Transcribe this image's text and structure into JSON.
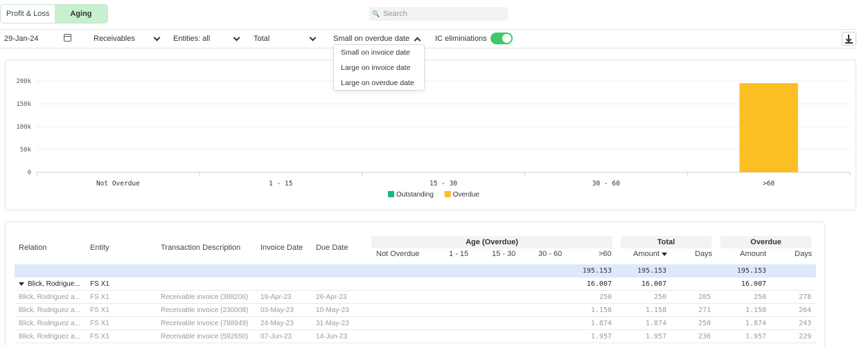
{
  "tabs": [
    {
      "label": "Profit & Loss",
      "active": false
    },
    {
      "label": "Aging",
      "active": true
    }
  ],
  "search": {
    "placeholder": "Search",
    "icon": "search-icon"
  },
  "filters": {
    "date": "29-Jan-24",
    "type": "Receivables",
    "entities": "Entities: all",
    "scope": "Total",
    "sort": "Small on overdue date",
    "sort_options": [
      "Small on invoice date",
      "Large on invoice date",
      "Large on overdue date"
    ],
    "ic_label": "IC eliminiations",
    "ic_enabled": true
  },
  "colors": {
    "outstanding": "#1db87a",
    "overdue": "#fbbf24",
    "accent": "#3ec86a",
    "highlight_row": "#dbe9fb"
  },
  "chart_data": {
    "type": "bar",
    "categories": [
      "Not Overdue",
      "1 - 15",
      "15 - 30",
      "30 - 60",
      ">60"
    ],
    "series": [
      {
        "name": "Outstanding",
        "values": [
          0,
          0,
          0,
          0,
          0
        ]
      },
      {
        "name": "Overdue",
        "values": [
          0,
          0,
          0,
          0,
          195153
        ]
      }
    ],
    "y_ticks": [
      "0",
      "50k",
      "100k",
      "150k",
      "200k"
    ],
    "ylim": [
      0,
      200000
    ],
    "grid": true,
    "legend_placement": "bottom-center"
  },
  "table": {
    "headers": {
      "relation": "Relation",
      "entity": "Entity",
      "description": "Transaction Description",
      "invoice_date": "Invoice Date",
      "due_date": "Due Date",
      "age_group": "Age (Overdue)",
      "not_overdue": "Not Overdue",
      "b1_15": "1 - 15",
      "b15_30": "15 - 30",
      "b30_60": "30 - 60",
      "b60": ">60",
      "total_group": "Total",
      "total_amount": "Amount",
      "total_days": "Days",
      "overdue_group": "Overdue",
      "overdue_amount": "Amount",
      "overdue_days": "Days"
    },
    "summary": {
      "b60": "195.153",
      "total_amount": "195.153",
      "overdue_amount": "195.153"
    },
    "group": {
      "relation": "Blick, Rodrigue...",
      "entity": "FS X1",
      "b60": "16.007",
      "total_amount": "16.007",
      "overdue_amount": "16.007"
    },
    "rows": [
      {
        "relation": "Blick, Rodriguez a...",
        "entity": "FS X1",
        "description": "Receivable invoice (388206)",
        "invoice_date": "19-Apr-23",
        "due_date": "26-Apr-23",
        "b60": "250",
        "total_amount": "250",
        "total_days": "285",
        "overdue_amount": "250",
        "overdue_days": "278"
      },
      {
        "relation": "Blick, Rodriguez a...",
        "entity": "FS X1",
        "description": "Receivable invoice (230008)",
        "invoice_date": "03-May-23",
        "due_date": "10-May-23",
        "b60": "1.158",
        "total_amount": "1.158",
        "total_days": "271",
        "overdue_amount": "1.158",
        "overdue_days": "264"
      },
      {
        "relation": "Blick, Rodriguez a...",
        "entity": "FS X1",
        "description": "Receivable invoice (788949)",
        "invoice_date": "24-May-23",
        "due_date": "31-May-23",
        "b60": "1.874",
        "total_amount": "1.874",
        "total_days": "250",
        "overdue_amount": "1.874",
        "overdue_days": "243"
      },
      {
        "relation": "Blick, Rodriguez a...",
        "entity": "FS X1",
        "description": "Receivable invoice (592650)",
        "invoice_date": "07-Jun-23",
        "due_date": "14-Jun-23",
        "b60": "1.957",
        "total_amount": "1.957",
        "total_days": "236",
        "overdue_amount": "1.957",
        "overdue_days": "229"
      }
    ]
  }
}
